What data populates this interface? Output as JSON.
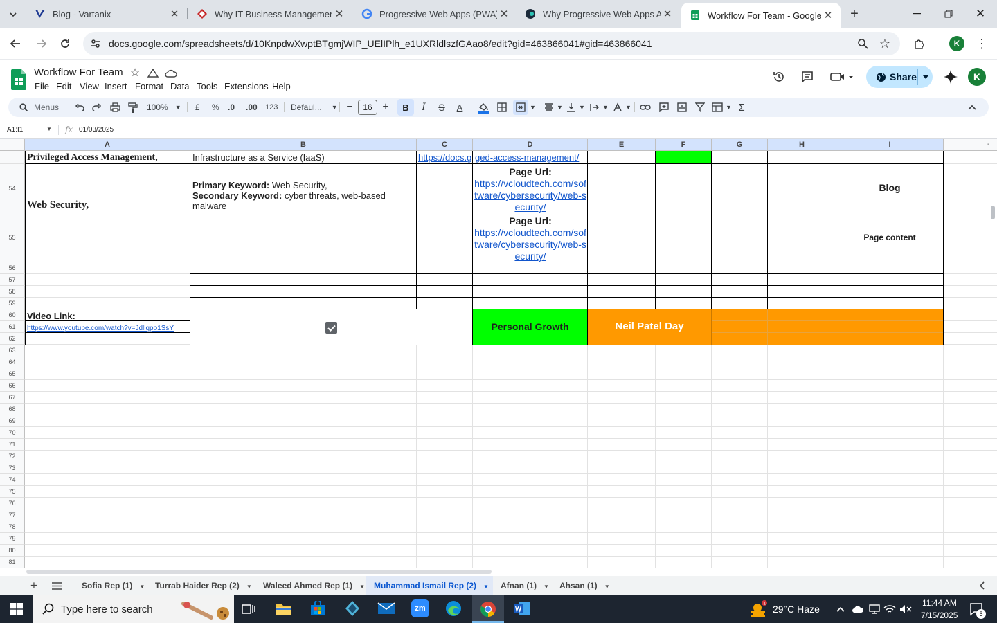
{
  "browser": {
    "tabs": [
      {
        "title": "Blog - Vartanix"
      },
      {
        "title": "Why IT Business Management"
      },
      {
        "title": "Progressive Web Apps (PWA) W"
      },
      {
        "title": "Why Progressive Web Apps Arc"
      },
      {
        "title": "Workflow For Team - Google Sl"
      }
    ],
    "url": "docs.google.com/spreadsheets/d/10KnpdwXwptBTgmjWIP_UElIPlh_e1UXRldlszfGAao8/edit?gid=463866041#gid=463866041",
    "profile_initial": "K"
  },
  "sheets": {
    "doc_title": "Workflow For Team",
    "menus": [
      "File",
      "Edit",
      "View",
      "Insert",
      "Format",
      "Data",
      "Tools",
      "Extensions",
      "Help"
    ],
    "share_label": "Share",
    "account_initial": "K",
    "toolbar": {
      "search_label": "Menus",
      "zoom": "100%",
      "currency": "£",
      "percent": "%",
      "dec_minus": ".0",
      "dec_plus": ".00",
      "number_format": "123",
      "font": "Defaul...",
      "font_size": "16"
    },
    "name_box": "A1:I1",
    "formula": "01/03/2025",
    "columns": [
      "A",
      "B",
      "C",
      "D",
      "E",
      "F",
      "G",
      "H",
      "I"
    ],
    "rows": [
      "54",
      "55",
      "56",
      "57",
      "58",
      "59",
      "60",
      "61",
      "62",
      "63",
      "64",
      "65",
      "66",
      "67",
      "68",
      "69",
      "70",
      "71",
      "72",
      "73",
      "74",
      "75",
      "76",
      "77",
      "78",
      "79",
      "80",
      "81"
    ],
    "cells": {
      "a53": "Privileged Access Management,",
      "b53": "Infrastructure as a Service (IaaS)",
      "c53": "https://docs.g",
      "d53": "ged-access-management/",
      "a54": "Web Security,",
      "b54_pk_label": "Primary Keyword:",
      "b54_pk": " Web Security,",
      "b54_sk_label": "Secondary Keyword:",
      "b54_sk": " cyber threats, web-based malware",
      "d54_label": "Page Url:",
      "d54_link": "https://vcloudtech.com/software/cybersecurity/web-security/",
      "i54": "Blog",
      "d55_label": "Page Url:",
      "d55_link": "https://vcloudtech.com/software/cybersecurity/web-security/",
      "i55": "Page content",
      "a60": "Video Link:",
      "a61": "https://www.youtube.com/watch?v=Jdllqpo1SsY",
      "d60": "Personal Growth",
      "e60": "Neil Patel Day"
    },
    "colors": {
      "green": "#00ff00",
      "orange": "#ff9900",
      "header_blue": "#d3e3fd",
      "link": "#1155cc"
    },
    "sheet_tabs": [
      "Sofia Rep (1)",
      "Turrab Haider Rep (2)",
      "Waleed Ahmed Rep (1)",
      "Muhammad Ismail Rep (2)",
      "Afnan (1)",
      "Ahsan (1)"
    ],
    "active_sheet": "Muhammad Ismail Rep (2)"
  },
  "taskbar": {
    "search_placeholder": "Type here to search",
    "weather": "29°C  Haze",
    "time": "11:44 AM",
    "date": "7/15/2025",
    "notif_count": "5"
  }
}
